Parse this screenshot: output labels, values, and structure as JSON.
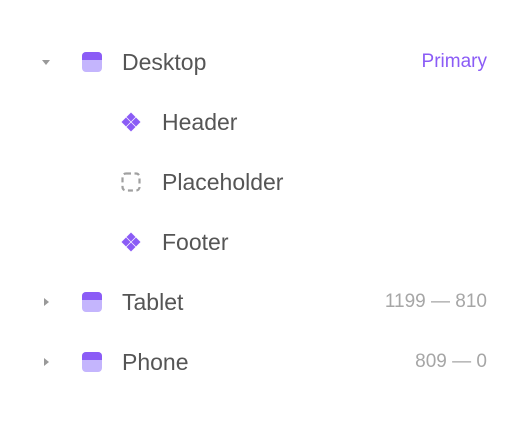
{
  "tree": {
    "items": [
      {
        "label": "Desktop",
        "meta": "Primary",
        "expanded": true,
        "icon": "breakpoint-icon",
        "children": [
          {
            "label": "Header",
            "icon": "component-icon"
          },
          {
            "label": "Placeholder",
            "icon": "placeholder-icon"
          },
          {
            "label": "Footer",
            "icon": "component-icon"
          }
        ]
      },
      {
        "label": "Tablet",
        "meta": "1199 — 810",
        "expanded": false,
        "icon": "breakpoint-icon"
      },
      {
        "label": "Phone",
        "meta": "809 — 0",
        "expanded": false,
        "icon": "breakpoint-icon"
      }
    ]
  },
  "colors": {
    "accent": "#8b5cf6",
    "accent_light": "#c4b5fd",
    "text": "#555555",
    "muted": "#a6a6a6",
    "chevron": "#999999"
  }
}
